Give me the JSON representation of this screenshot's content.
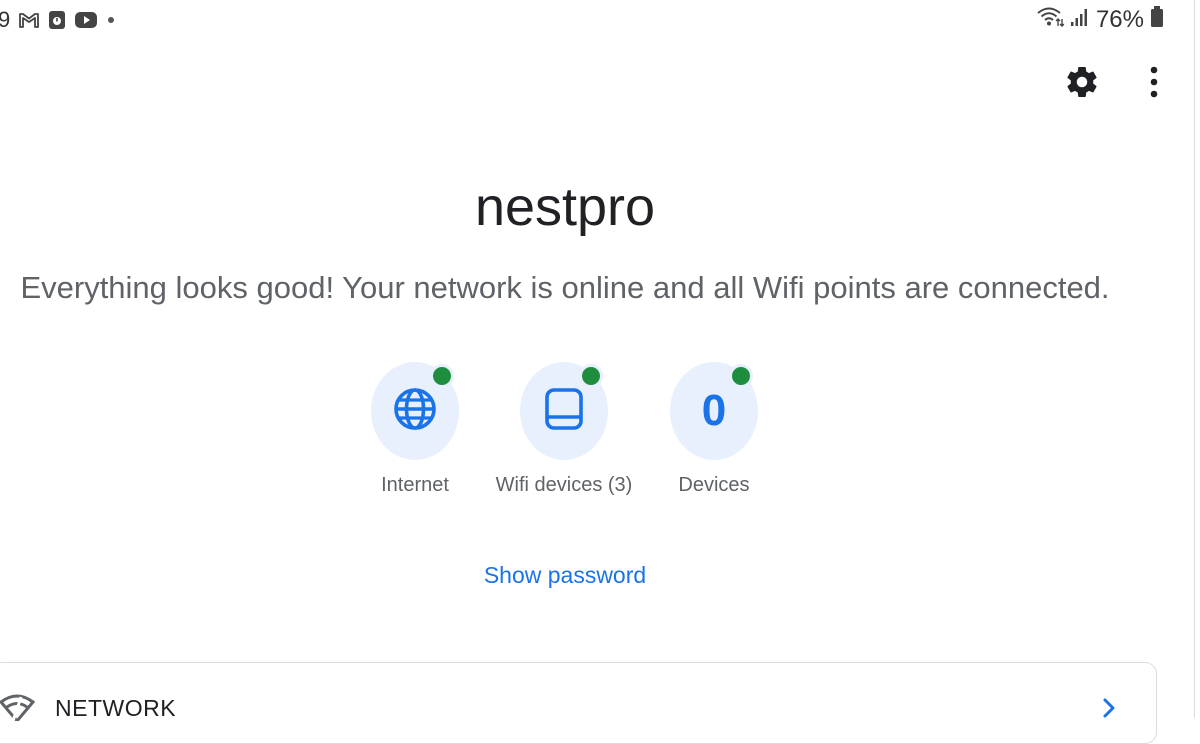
{
  "status_bar": {
    "time": "9",
    "battery": "76%",
    "left_icons": [
      "gmail-icon",
      "calendar-icon",
      "youtube-icon",
      "dot-icon"
    ],
    "right_icons": [
      "wifi-icon",
      "signal-icon",
      "battery-icon"
    ]
  },
  "toolbar": {
    "settings_icon": "gear-icon",
    "more_icon": "more-vert-icon"
  },
  "header": {
    "title": "nestpro",
    "message": "Everything looks good! Your network is online and all Wifi points are connected."
  },
  "tiles": [
    {
      "label": "Internet",
      "icon": "globe-icon",
      "status": "online",
      "status_color": "#1e8e3e"
    },
    {
      "label": "Wifi devices (3)",
      "icon": "tablet-icon",
      "status": "online",
      "status_color": "#1e8e3e"
    },
    {
      "label": "Devices",
      "count": "0",
      "status": "online",
      "status_color": "#1e8e3e"
    }
  ],
  "show_password": "Show password",
  "network_section": {
    "label": "NETWORK",
    "icon": "network-wifi-icon"
  },
  "colors": {
    "accent": "#1a73e8",
    "status_green": "#1e8e3e",
    "tile_bg": "#e8f0fe"
  }
}
